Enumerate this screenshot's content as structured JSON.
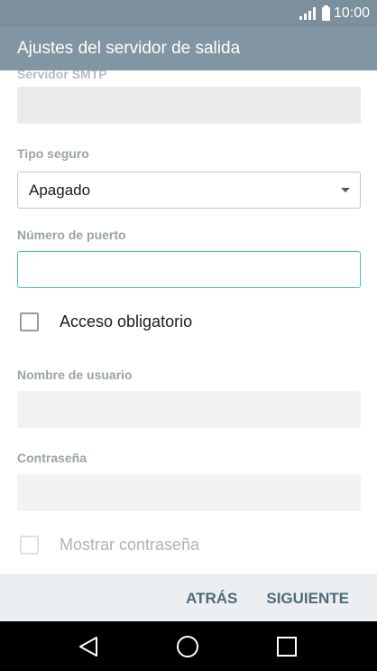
{
  "status_bar": {
    "time": "10:00",
    "signal_icon": "signal-icon",
    "battery_icon": "battery-icon"
  },
  "app_bar": {
    "title": "Ajustes del servidor de salida"
  },
  "form": {
    "smtp_server": {
      "label": "Servidor SMTP",
      "value": ""
    },
    "security_type": {
      "label": "Tipo seguro",
      "value": "Apagado",
      "icon": "dropdown-arrow-icon"
    },
    "port_number": {
      "label": "Número de puerto",
      "value": ""
    },
    "require_signin": {
      "label": "Acceso obligatorio",
      "checked": false
    },
    "username": {
      "label": "Nombre de usuario",
      "value": ""
    },
    "password": {
      "label": "Contraseña",
      "value": ""
    },
    "show_password": {
      "label": "Mostrar contraseña",
      "checked": false
    }
  },
  "bottom_bar": {
    "back_label": "ATRÁS",
    "next_label": "SIGUIENTE"
  },
  "nav_bar": {
    "back_icon": "back-triangle-icon",
    "home_icon": "home-circle-icon",
    "recents_icon": "recents-square-icon"
  },
  "colors": {
    "app_bar": "#8295a2",
    "status_bar": "#7b8f9c",
    "accent": "#42c2c2",
    "button_text": "#4f6a7a"
  }
}
